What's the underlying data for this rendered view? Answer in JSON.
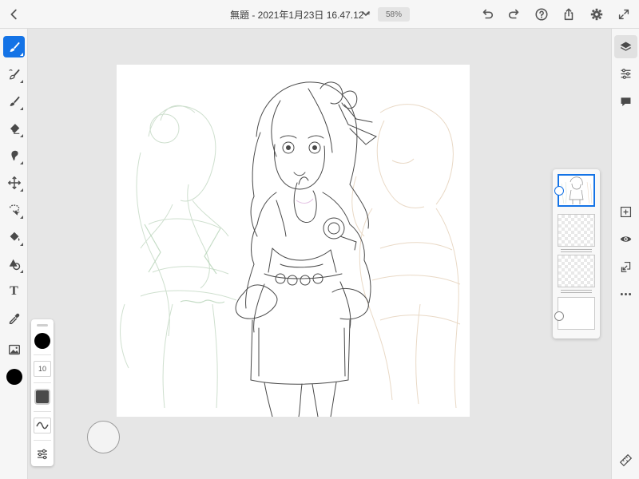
{
  "app": {
    "document_title": "無題 - 2021年1月23日 16.47.12 *",
    "zoom": "58%"
  },
  "colors": {
    "accent": "#1473e6",
    "current_color": "#000000",
    "toolbar_bg": "#f6f6f6",
    "workspace_bg": "#e6e6e6"
  },
  "top_bar": {
    "left": [
      "back-icon"
    ],
    "right": [
      "undo-icon",
      "redo-icon",
      "help-icon",
      "share-icon",
      "settings-icon",
      "fullscreen-icon"
    ]
  },
  "left_toolbar": {
    "tools": [
      {
        "name": "pixel-brush",
        "icon": "brush-icon",
        "active": true
      },
      {
        "name": "live-brush",
        "icon": "live-brush-icon",
        "active": false
      },
      {
        "name": "vector-brush",
        "icon": "vector-brush-icon",
        "active": false
      },
      {
        "name": "eraser",
        "icon": "eraser-icon",
        "active": false
      },
      {
        "name": "smudge",
        "icon": "smudge-icon",
        "active": false
      },
      {
        "name": "transform",
        "icon": "move-icon",
        "active": false
      },
      {
        "name": "selection",
        "icon": "lasso-icon",
        "active": false
      },
      {
        "name": "fill",
        "icon": "fill-bucket-icon",
        "active": false
      },
      {
        "name": "shapes",
        "icon": "shapes-icon",
        "active": false
      },
      {
        "name": "text",
        "icon": "text-icon",
        "label": "T",
        "active": false
      },
      {
        "name": "eyedropper",
        "icon": "eyedropper-icon",
        "active": false
      },
      {
        "name": "image",
        "icon": "image-icon",
        "active": false
      }
    ]
  },
  "brush_panel": {
    "color": "#000000",
    "size": "10",
    "opacity_color": "#4a4a4a",
    "icons": [
      "stroke-smoothing-icon",
      "brush-settings-icon"
    ]
  },
  "layers": [
    {
      "name": "layer-1",
      "selected": true,
      "has_content": true
    },
    {
      "name": "layer-2",
      "selected": false,
      "has_content": false
    },
    {
      "name": "layer-3",
      "selected": false,
      "has_content": false
    },
    {
      "name": "background",
      "selected": false,
      "has_content": false
    }
  ],
  "right_toolbar": {
    "top": [
      "layers-icon",
      "adjustments-icon",
      "comments-icon"
    ],
    "middle": [
      "add-layer-icon",
      "visibility-icon",
      "import-icon",
      "more-icon"
    ],
    "bottom": [
      "ruler-icon"
    ]
  }
}
